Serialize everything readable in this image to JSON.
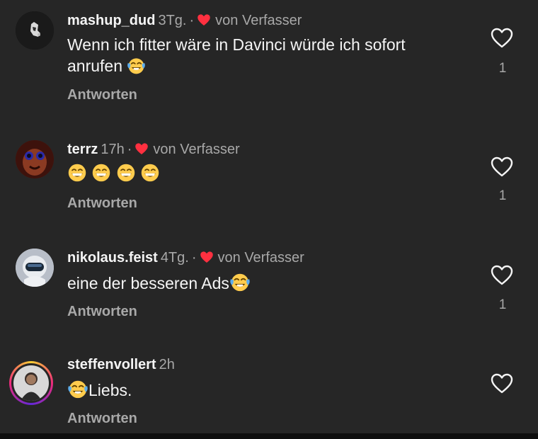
{
  "comments": [
    {
      "username": "mashup_dud",
      "time": "3Tg.",
      "separator": "·",
      "by_author": "von Verfasser",
      "author_liked": true,
      "text": "Wenn ich fitter wäre in Davinci würde ich sofort anrufen",
      "emojis": [
        "face-with-tears-of-joy"
      ],
      "reply_label": "Antworten",
      "like_count": "1"
    },
    {
      "username": "terrz",
      "time": "17h",
      "separator": "·",
      "by_author": "von Verfasser",
      "author_liked": true,
      "text": "",
      "emojis": [
        "grinning-face",
        "grinning-face",
        "grinning-face",
        "grinning-face"
      ],
      "reply_label": "Antworten",
      "like_count": "1"
    },
    {
      "username": "nikolaus.feist",
      "time": "4Tg.",
      "separator": "·",
      "by_author": "von Verfasser",
      "author_liked": true,
      "text": "eine der besseren Ads",
      "emojis": [
        "face-with-tears-of-joy"
      ],
      "reply_label": "Antworten",
      "like_count": "1"
    },
    {
      "username": "steffenvollert",
      "time": "2h",
      "separator": "",
      "by_author": "",
      "author_liked": false,
      "text": "Liebs.",
      "emojis": [
        "face-with-tears-of-joy"
      ],
      "reply_label": "Antworten",
      "like_count": "",
      "has_story_ring": true
    }
  ],
  "colors": {
    "background": "#262626",
    "primary_text": "#f5f5f5",
    "secondary_text": "#a8a8a8",
    "author_heart": "#ff3040"
  }
}
